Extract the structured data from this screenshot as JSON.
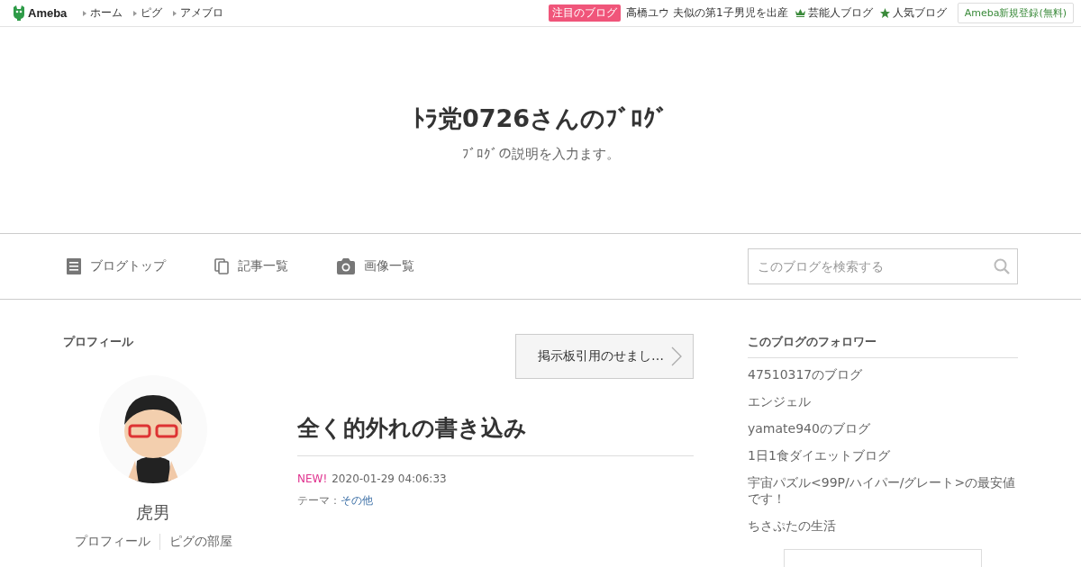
{
  "topbar": {
    "logo": "Ameba",
    "links": [
      "ホーム",
      "ピグ",
      "アメブロ"
    ],
    "featured_badge": "注目のブログ",
    "featured_text": "高橋ユウ 夫似の第1子男児を出産",
    "celebrity_link": "芸能人ブログ",
    "popular_link": "人気ブログ",
    "signup_button": "Ameba新規登録(無料)"
  },
  "header": {
    "title": "ﾄﾗ党0726さんのﾌﾞﾛｸﾞ",
    "subtitle": "ﾌﾞﾛｸﾞの説明を入力ます。"
  },
  "nav": {
    "items": [
      {
        "label": "ブログトップ",
        "kind": "document"
      },
      {
        "label": "記事一覧",
        "kind": "copy"
      },
      {
        "label": "画像一覧",
        "kind": "camera"
      }
    ],
    "search": {
      "placeholder": "このブログを検索する"
    }
  },
  "profile": {
    "heading": "プロフィール",
    "avatar": {
      "kind": "picture"
    },
    "name": "虎男",
    "links": [
      "プロフィール",
      "ピグの部屋"
    ]
  },
  "article": {
    "prev_button": "掲示板引用のせまし…",
    "title": "全く的外れの書き込み",
    "new_badge": "NEW!",
    "date": "2020-01-29 04:06:33",
    "theme_label": "テーマ：",
    "theme": "その他"
  },
  "followers": {
    "heading": "このブログのフォロワー",
    "items": [
      "47510317のブログ",
      "エンジェル",
      "yamate940のブログ",
      "1日1食ダイエットブログ",
      "宇宙パズル<99P/ハイパー/グレート>の最安値です！",
      "ちさぷたの生活"
    ]
  }
}
